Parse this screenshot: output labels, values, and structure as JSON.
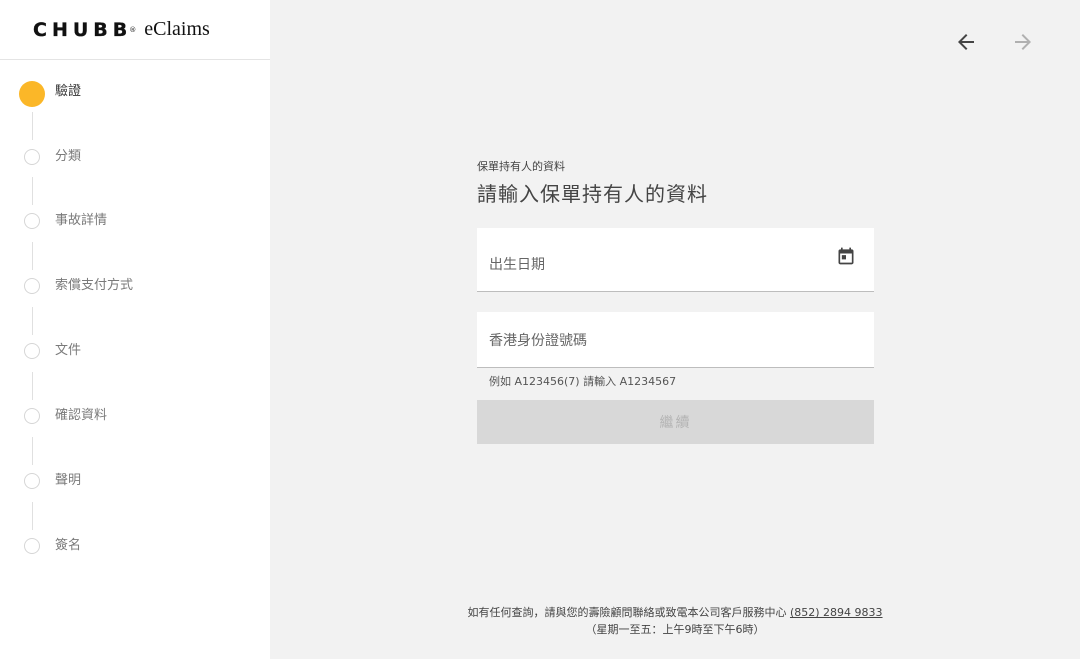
{
  "header": {
    "brand": "CHUBB",
    "brand_mark": "®",
    "product": "eClaims"
  },
  "sidebar": {
    "steps": [
      {
        "label": "驗證",
        "active": true
      },
      {
        "label": "分類",
        "active": false
      },
      {
        "label": "事故詳情",
        "active": false
      },
      {
        "label": "索償支付方式",
        "active": false
      },
      {
        "label": "文件",
        "active": false
      },
      {
        "label": "確認資料",
        "active": false
      },
      {
        "label": "聲明",
        "active": false
      },
      {
        "label": "簽名",
        "active": false
      }
    ]
  },
  "nav": {
    "back_icon": "arrow-left-icon",
    "forward_icon": "arrow-right-icon"
  },
  "form": {
    "section_label": "保單持有人的資料",
    "title": "請輸入保單持有人的資料",
    "dob_label": "出生日期",
    "dob_icon": "calendar-icon",
    "hkid_label": "香港身份證號碼",
    "hkid_helper": "例如 A123456(7) 請輸入 A1234567",
    "continue_label": "繼續"
  },
  "footer": {
    "line1_text": "如有任何查詢，請與您的壽險顧問聯絡或致電本公司客戶服務中心 ",
    "phone": "(852) 2894 9833",
    "line2": "（星期一至五：上午9時至下午6時）"
  },
  "colors": {
    "accent": "#fbb728",
    "sidebar_bg": "#ffffff",
    "main_bg": "#f2f2f2",
    "button_disabled_bg": "#d8d8d8"
  }
}
